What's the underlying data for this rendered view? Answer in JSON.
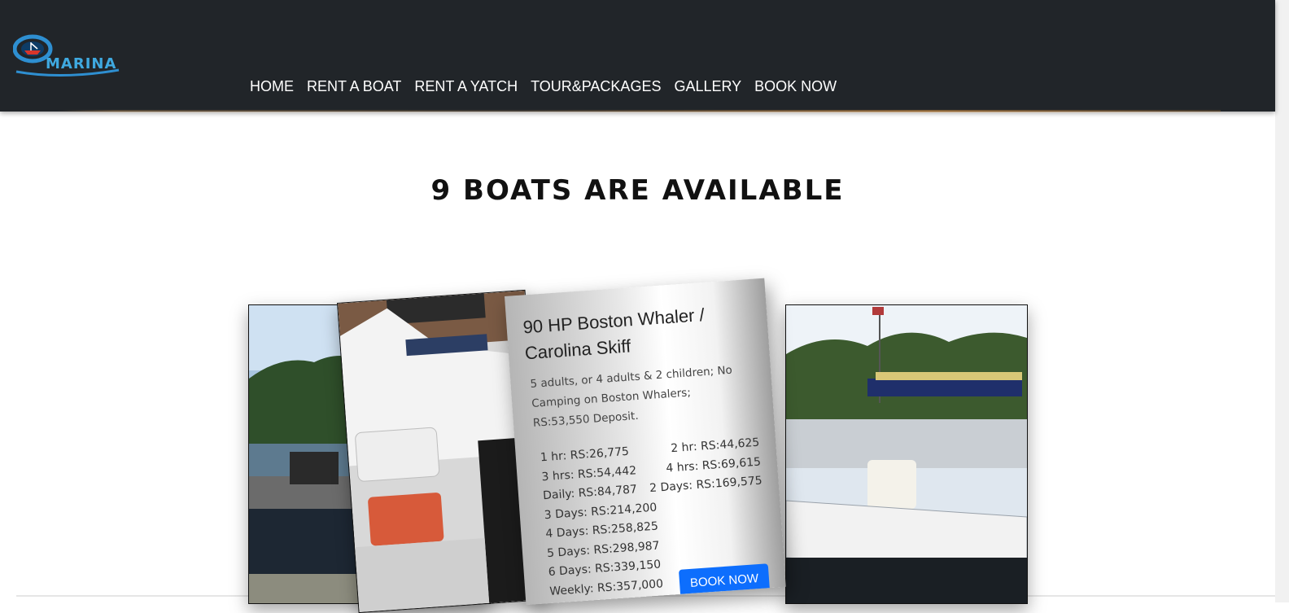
{
  "brand": {
    "logo_text": "MARINA"
  },
  "nav": {
    "items": [
      {
        "label": "HOME"
      },
      {
        "label": "RENT A BOAT"
      },
      {
        "label": "RENT A YATCH"
      },
      {
        "label": "TOUR&PACKAGES"
      },
      {
        "label": "GALLERY"
      },
      {
        "label": "BOOK NOW"
      }
    ]
  },
  "main": {
    "heading": "9 BOATS ARE AVAILABLE"
  },
  "featured_boat": {
    "title": "90 HP Boston Whaler / Carolina Skiff",
    "description": "5 adults, or 4 adults & 2 children; No Camping on Boston Whalers; RS:53,550 Deposit.",
    "prices": [
      [
        "1 hr: RS:26,775",
        "2 hr: RS:44,625"
      ],
      [
        "3 hrs: RS:54,442",
        "4 hrs: RS:69,615"
      ],
      [
        "Daily: RS:84,787",
        "2 Days: RS:169,575"
      ],
      [
        "3 Days: RS:214,200",
        ""
      ],
      [
        "4 Days: RS:258,825",
        ""
      ],
      [
        "5 Days: RS:298,987",
        ""
      ],
      [
        "6 Days: RS:339,150",
        ""
      ],
      [
        "Weekly: RS:357,000",
        ""
      ]
    ],
    "book_label": "BOOK NOW"
  },
  "colors": {
    "navbar": "#212529",
    "accent_button": "#0d6efd",
    "logo_blue": "#3fa9e0"
  },
  "icons": {
    "logo": "ship-in-ring-icon"
  }
}
